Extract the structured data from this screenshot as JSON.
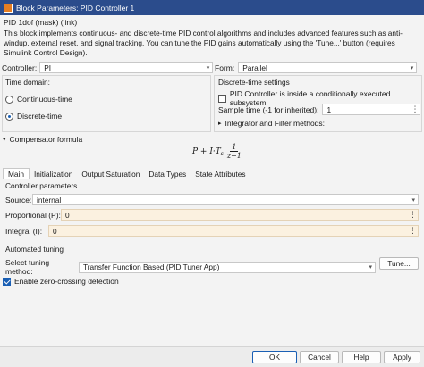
{
  "window": {
    "title": "Block Parameters: PID Controller 1"
  },
  "header": {
    "block_name": "PID 1dof (mask) (link)",
    "description": "This block implements continuous- and discrete-time PID control algorithms and includes advanced features such as anti-windup, external reset, and signal tracking. You can tune the PID gains automatically using the 'Tune...' button (requires Simulink Control Design)."
  },
  "controller": {
    "label": "Controller:",
    "value": "PI"
  },
  "form": {
    "label": "Form:",
    "value": "Parallel"
  },
  "time_domain": {
    "title": "Time domain:",
    "options": [
      {
        "label": "Continuous-time",
        "selected": false
      },
      {
        "label": "Discrete-time",
        "selected": true
      }
    ]
  },
  "discrete_settings": {
    "title": "Discrete-time settings",
    "conditional_label": "PID Controller is inside a conditionally executed subsystem",
    "conditional_checked": false,
    "sample_time_label": "Sample time (-1 for inherited):",
    "sample_time_value": "1",
    "integrator_label": "Integrator and Filter methods:"
  },
  "compensator": {
    "label": "Compensator formula",
    "formula_lead": "P + I·T",
    "formula_sub": "s",
    "formula_num": "1",
    "formula_den": "z−1"
  },
  "tabs": [
    {
      "label": "Main",
      "active": true
    },
    {
      "label": "Initialization",
      "active": false
    },
    {
      "label": "Output Saturation",
      "active": false
    },
    {
      "label": "Data Types",
      "active": false
    },
    {
      "label": "State Attributes",
      "active": false
    }
  ],
  "params": {
    "title": "Controller parameters",
    "source_label": "Source:",
    "source_value": "internal",
    "p_label": "Proportional (P):",
    "p_value": "0",
    "i_label": "Integral (I):",
    "i_value": "0"
  },
  "tuning": {
    "title": "Automated tuning",
    "method_label": "Select tuning method:",
    "method_value": "Transfer Function Based (PID Tuner App)",
    "tune_button": "Tune..."
  },
  "zero_crossing": {
    "label": "Enable zero-crossing detection",
    "checked": true
  },
  "buttons": {
    "ok": "OK",
    "cancel": "Cancel",
    "help": "Help",
    "apply": "Apply"
  },
  "colors": {
    "accent": "#1a5fb4",
    "titlebar": "#2b4c8c",
    "field_tint": "#fbf1e0"
  }
}
